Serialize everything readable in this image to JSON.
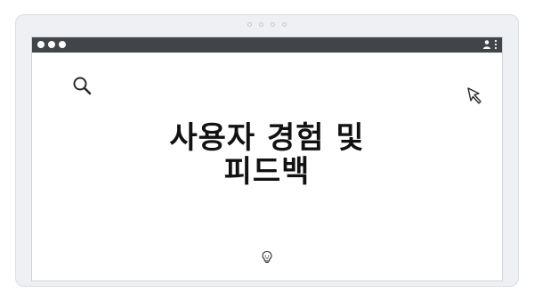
{
  "slide": {
    "title_line1": "사용자 경험 및",
    "title_line2": "피드백"
  },
  "icons": {
    "search": "search-icon",
    "cursor": "cursor-icon",
    "bulb": "lightbulb-icon",
    "user": "user-icon",
    "menu": "kebab-menu-icon"
  },
  "colors": {
    "titlebar": "#414449",
    "card_background": "#eef0f3",
    "title_text": "#121212"
  }
}
